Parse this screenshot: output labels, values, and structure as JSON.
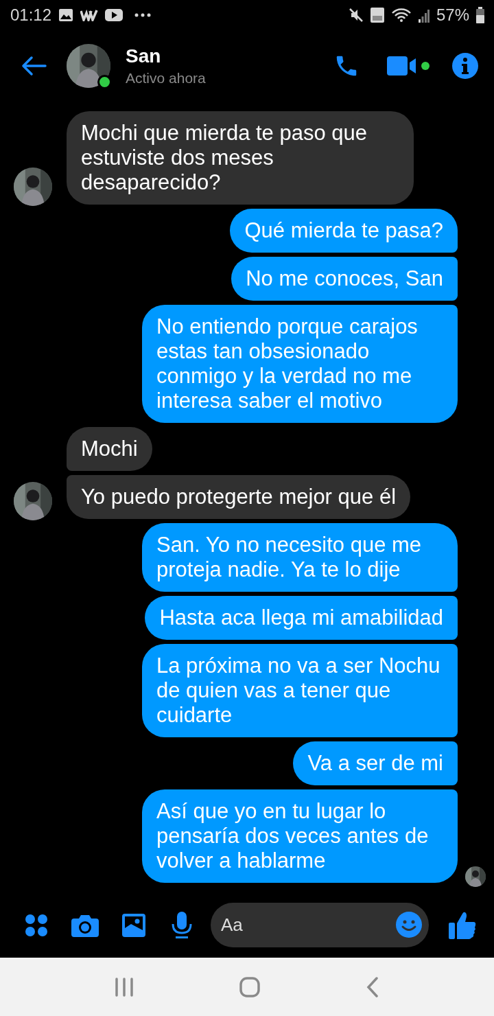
{
  "status_bar": {
    "time": "01:12",
    "battery": "57%"
  },
  "header": {
    "name": "San",
    "status": "Activo ahora",
    "online": true
  },
  "messages": [
    {
      "kind": "in",
      "text": "Mochi que mierda te paso que estuviste dos meses desaparecido?",
      "avatar": true
    },
    {
      "kind": "out",
      "text": "Qué mierda te pasa?"
    },
    {
      "kind": "out",
      "text": "No me conoces, San"
    },
    {
      "kind": "out",
      "text": "No entiendo porque carajos estas tan obsesionado conmigo y la verdad no me interesa saber el motivo"
    },
    {
      "kind": "in",
      "text": "Mochi",
      "avatar": false
    },
    {
      "kind": "in",
      "text": "Yo puedo protegerte mejor que él",
      "avatar": true
    },
    {
      "kind": "out",
      "text": "San. Yo no necesito que me proteja nadie. Ya te lo dije"
    },
    {
      "kind": "out",
      "text": "Hasta aca llega mi amabilidad"
    },
    {
      "kind": "out",
      "text": "La próxima no va a ser Nochu de quien vas a tener que cuidarte"
    },
    {
      "kind": "out",
      "text": "Va a ser de mi"
    },
    {
      "kind": "out",
      "text": "Así que yo en tu lugar lo pensaría dos veces antes de volver a hablarme"
    }
  ],
  "read_receipt": true,
  "composer": {
    "placeholder": "Aa"
  }
}
